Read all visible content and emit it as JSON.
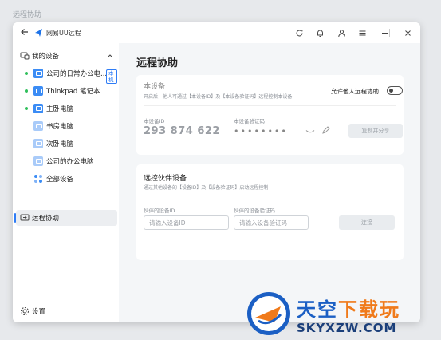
{
  "outer_title": "远程协助",
  "titlebar": {
    "app_name": "网易UU远程",
    "icons": [
      "refresh-icon",
      "bell-icon",
      "user-icon",
      "menu-icon",
      "minimize-icon",
      "close-icon"
    ]
  },
  "sidebar": {
    "section_label": "我的设备",
    "devices": [
      {
        "label": "公司的日常办公电...",
        "online": true,
        "badge": "本机"
      },
      {
        "label": "Thinkpad 笔记本",
        "online": true
      },
      {
        "label": "主卧电脑",
        "online": true
      },
      {
        "label": "书房电脑",
        "online": false
      },
      {
        "label": "次卧电脑",
        "online": false
      },
      {
        "label": "公司的办公电脑",
        "online": false
      }
    ],
    "all_devices": "全部设备",
    "remote_assist": "远程协助",
    "settings": "设置"
  },
  "main": {
    "title": "远程协助",
    "this_device": {
      "title": "本设备",
      "subtitle": "开启后，他人可通过【本设备ID】及【本设备验证码】远程控制本设备",
      "allow_label": "允许他人远程协助",
      "id_label": "本设备ID",
      "id_value": "293 874 622",
      "code_label": "本设备验证码",
      "code_value": "••••••••",
      "copy_button": "复制并分享"
    },
    "partner": {
      "title": "远控伙伴设备",
      "subtitle": "通过其他设备的【设备ID】及【设备验证码】启动远程控制",
      "id_label": "伙伴的设备ID",
      "id_placeholder": "请输入设备ID",
      "code_label": "伙伴的设备验证码",
      "code_placeholder": "请输入设备验证码",
      "connect_button": "连接"
    }
  },
  "watermark": {
    "line1_a": "天空",
    "line1_b": "下载玩",
    "line2": "SKYXZW.COM"
  },
  "colors": {
    "accent": "#2e7cf6",
    "online": "#2fbf5b",
    "device_icon": "#3b8cf5",
    "device_icon_light": "#a9cbf9"
  }
}
